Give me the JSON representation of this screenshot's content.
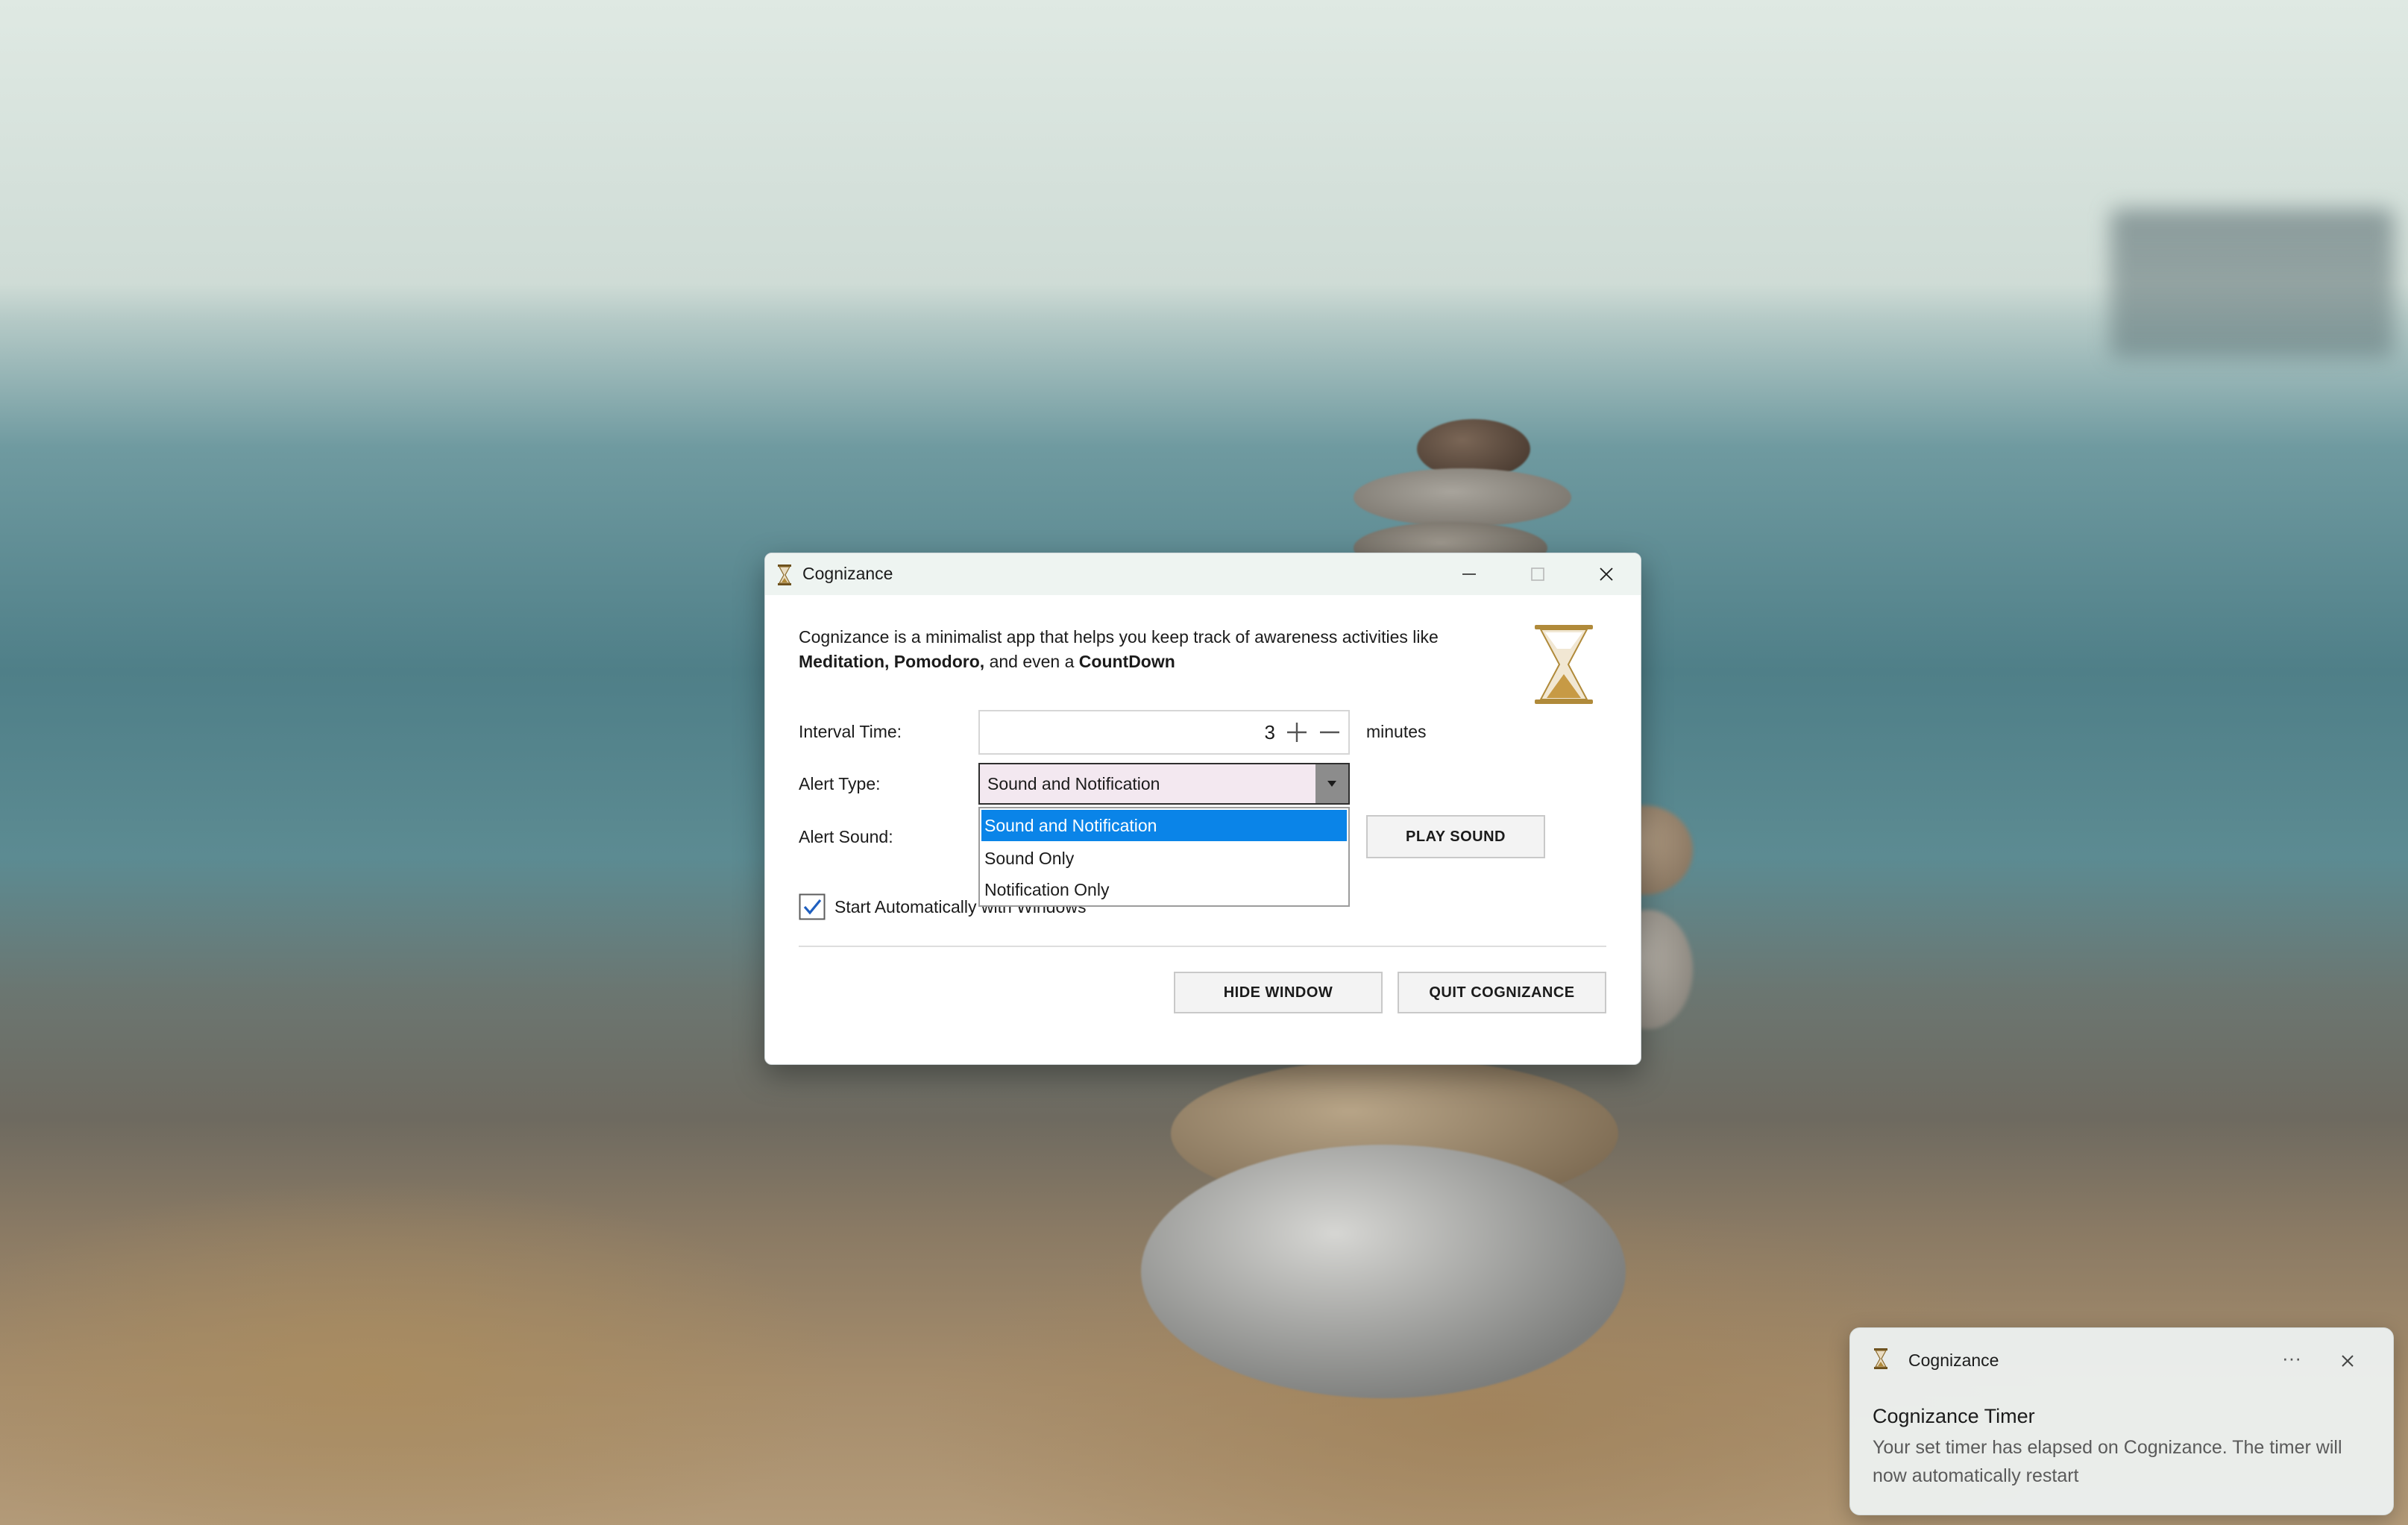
{
  "window": {
    "title": "Cognizance",
    "intro_prefix": "Cognizance is a minimalist app that helps you keep track of awareness activities like",
    "intro_bold1": "Meditation,",
    "intro_bold2": "Pomodoro,",
    "intro_mid": "and even a",
    "intro_bold3": "CountDown",
    "controls": {
      "interval_label": "Interval Time:",
      "interval_value": "3",
      "interval_unit": "minutes",
      "alert_type_label": "Alert Type:",
      "alert_type_value": "Sound and Notification",
      "alert_type_options": [
        "Sound and Notification",
        "Sound Only",
        "Notification Only"
      ],
      "alert_sound_label": "Alert Sound:",
      "play_sound_label": "PLAY SOUND",
      "start_auto_label": "Start Automatically with Windows",
      "start_auto_checked": true
    },
    "buttons": {
      "hide_label": "HIDE WINDOW",
      "quit_label": "QUIT COGNIZANCE"
    }
  },
  "toast": {
    "app_name": "Cognizance",
    "more_label": "···",
    "title": "Cognizance Timer",
    "body": "Your set timer has elapsed on Cognizance. The timer will now automatically restart"
  },
  "colors": {
    "accent": "#0a84e8",
    "combo_bg": "#f3e8f0",
    "hourglass_gold": "#b08a3a"
  },
  "icons": [
    "hourglass-icon",
    "minimize-icon",
    "maximize-icon",
    "close-icon",
    "plus-icon",
    "minus-icon",
    "chevron-down-icon",
    "checkmark-icon",
    "more-icon"
  ]
}
